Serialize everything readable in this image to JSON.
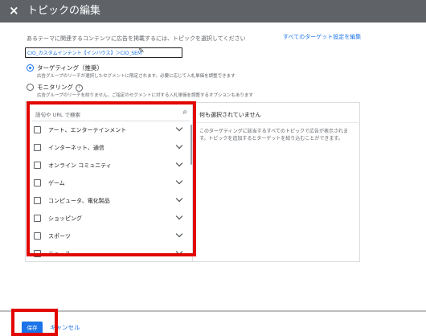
{
  "header": {
    "close_icon": "×",
    "title": "トピックの編集"
  },
  "intro": {
    "hint": "あるテーマに関連するコンテンツに広告を掲載するには、トピックを選択してください",
    "edit_all_link": "すべてのターゲット設定を編集",
    "context_value": "CIO_カスタムインテント【インハウス】＞CIO_SEM",
    "pencil_icon": "✎"
  },
  "options": [
    {
      "title": "ターゲティング（推奨）",
      "description": "広告グループのリーチが選択したセグメントに限定されます。必要に応じて入札単価を調整できます",
      "selected": true
    },
    {
      "title": "モニタリング",
      "description": "広告グループのリーチを絞りません。ご指定のセグメントに対する入札単価を調整するオプションもあります",
      "help_icon": "?",
      "selected": false
    }
  ],
  "left_panel": {
    "search_placeholder": "語句や URL で検索",
    "search_icon": "⌕",
    "items": [
      {
        "label": "アート、エンターテインメント"
      },
      {
        "label": "インターネット、通信"
      },
      {
        "label": "オンライン コミュニティ"
      },
      {
        "label": "ゲーム"
      },
      {
        "label": "コンピュータ、電化製品"
      },
      {
        "label": "ショッピング"
      },
      {
        "label": "スポーツ"
      },
      {
        "label": "ニュース"
      }
    ]
  },
  "right_panel": {
    "heading": "何も選択されていません",
    "description": "このターゲティングに該当するすべてのトピックで広告が表示されます。トピックを追加するとターゲットを絞り込むことができます。"
  },
  "footer": {
    "save_label": "保存",
    "cancel_label": "キャンセル"
  },
  "colors": {
    "accent": "#1a73e8",
    "highlight": "#e10600",
    "topbar": "#5f6368"
  }
}
